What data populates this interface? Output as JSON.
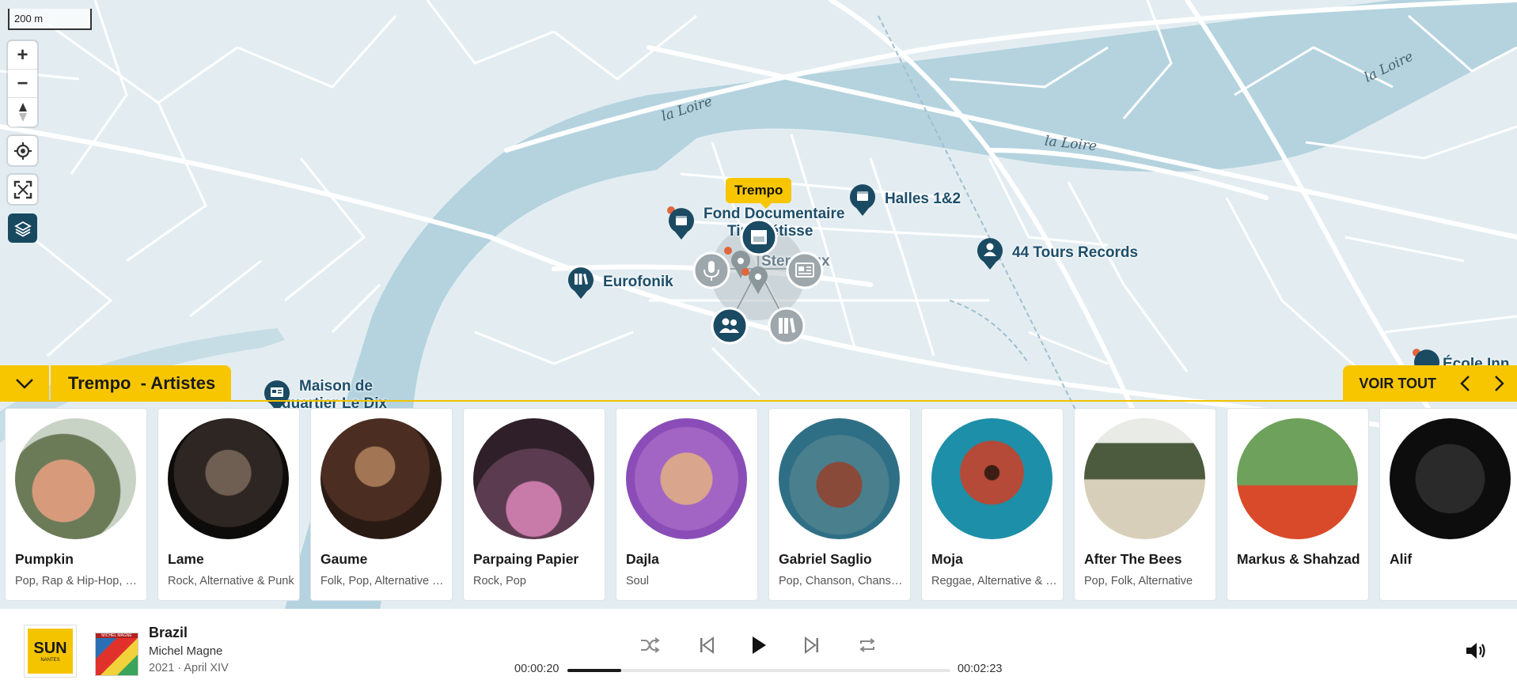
{
  "map": {
    "scale_label": "200 m",
    "controls": {
      "zoom_in": "+",
      "zoom_out": "−",
      "compass": "compass-icon",
      "locate": "locate-icon",
      "fullscreen": "fullscreen-icon",
      "layers": "layers-icon"
    },
    "river_labels": [
      "la Loire",
      "la Loire",
      "la Loire"
    ],
    "tooltip": "Trempo",
    "pois": {
      "fond_documentaire_line1": "Fond Documentaire",
      "fond_documentaire_line2": "Tipi Métisse",
      "halles": "Halles 1&2",
      "tours_records": "44 Tours Records",
      "eurofonik": "Eurofonik",
      "stereolux": "Stereolux",
      "maison_line1": "Maison de",
      "maison_line2": "quartier Le Dix",
      "ecole": "École Inn"
    },
    "colors": {
      "pin": "#1b4a63",
      "pin_grey": "#9ea7ab",
      "accent": "#f7c600",
      "water": "#b4d3df"
    }
  },
  "panel": {
    "title": "Trempo  - Artistes",
    "voir_tout": "VOIR TOUT",
    "artists": [
      {
        "name": "Pumpkin",
        "genres": "Pop, Rap & Hip-Hop, Soul"
      },
      {
        "name": "Lame",
        "genres": "Rock, Alternative & Punk"
      },
      {
        "name": "Gaume",
        "genres": "Folk, Pop, Alternative & Rock"
      },
      {
        "name": "Parpaing Papier",
        "genres": "Rock, Pop"
      },
      {
        "name": "Dajla",
        "genres": "Soul"
      },
      {
        "name": "Gabriel Saglio",
        "genres": "Pop, Chanson, Chanson française"
      },
      {
        "name": "Moja",
        "genres": "Reggae, Alternative & Rock"
      },
      {
        "name": "After The Bees",
        "genres": "Pop, Folk, Alternative"
      },
      {
        "name": "Markus & Shahzad",
        "genres": ""
      },
      {
        "name": "Alif",
        "genres": ""
      }
    ]
  },
  "player": {
    "station_logo_text": "SUN",
    "station_logo_sub": "NANTES",
    "cover_text": "MICHEL MAGNE",
    "title": "Brazil",
    "artist": "Michel Magne",
    "album": "2021 · April XIV",
    "elapsed": "00:00:20",
    "duration": "00:02:23",
    "progress_fraction": 0.14
  }
}
